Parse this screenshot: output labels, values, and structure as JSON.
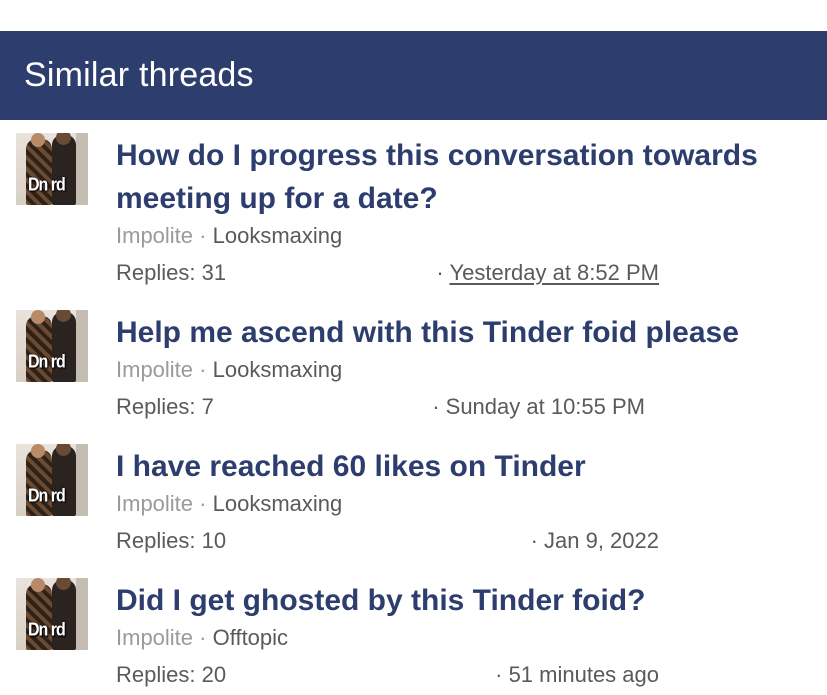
{
  "section_title": "Similar threads",
  "avatar_tag": "Dn rd",
  "threads": [
    {
      "title_line1": "How do I progress this conversation towards",
      "title_line2": "meeting up for a date?",
      "prefix": "Impolite",
      "forum": "Looksmaxing",
      "replies": "Replies: 31",
      "date": "Yesterday at 8:52 PM"
    },
    {
      "title_line1": "Help me ascend with this Tinder foid please",
      "prefix": "Impolite",
      "forum": "Looksmaxing",
      "replies": "Replies: 7",
      "date": "Sunday at 10:55 PM"
    },
    {
      "title_line1": "I have reached 60 likes on Tinder",
      "prefix": "Impolite",
      "forum": "Looksmaxing",
      "replies": "Replies: 10",
      "date": "Jan 9, 2022"
    },
    {
      "title_line1": "Did I get ghosted by this Tinder foid?",
      "prefix": "Impolite",
      "forum": "Offtopic",
      "replies": "Replies: 20",
      "date": "51 minutes ago"
    }
  ]
}
